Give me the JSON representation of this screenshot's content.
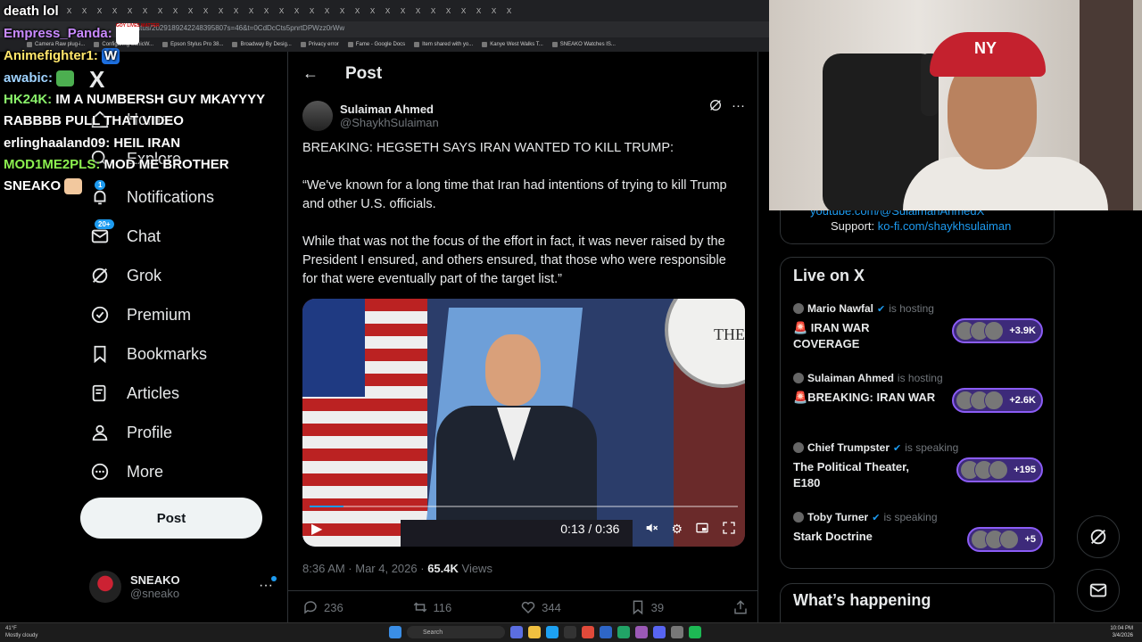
{
  "browser": {
    "url": "...atus/2029189242248395807s=46&t=0CdDcCts5pnrtDPWzz0rWw",
    "bookmarks": [
      "Camera Raw plug-i...",
      "Configuring SonicW...",
      "Epson Stylus Pro 38...",
      "Broadway By Desig...",
      "Privacy error",
      "Fame - Google Docs",
      "Item shared with yo...",
      "Kanye West Walks T...",
      "SNEAKO Watches IS..."
    ]
  },
  "chat": {
    "messages": [
      {
        "user": "",
        "text": "death lol"
      },
      {
        "user": "Empress_Panda:",
        "text": ""
      },
      {
        "user": "Animefighter1:",
        "text": ""
      },
      {
        "user": "awabic:",
        "text": ""
      },
      {
        "user": "HK24K:",
        "text": "IM A NUMBERSH GUY MKAYYYY RABBBB PULL THAT VIDEO"
      },
      {
        "user": "",
        "text": "erlinghaaland09: HEIL IRAN"
      },
      {
        "user": "MOD1ME2PLS:",
        "text": "MOD ME BROTHER SNEAKO"
      }
    ],
    "emote_text": "GOY LIVES MATTER",
    "w_emote": "W"
  },
  "sidebar": {
    "logo": "X",
    "items": [
      {
        "label": "Home",
        "icon": "home-icon"
      },
      {
        "label": "Explore",
        "icon": "search-icon"
      },
      {
        "label": "Notifications",
        "icon": "bell-icon",
        "badge": "1"
      },
      {
        "label": "Chat",
        "icon": "mail-icon",
        "badge": "20+"
      },
      {
        "label": "Grok",
        "icon": "grok-icon"
      },
      {
        "label": "Premium",
        "icon": "verified-icon"
      },
      {
        "label": "Bookmarks",
        "icon": "bookmark-icon"
      },
      {
        "label": "Articles",
        "icon": "articles-icon"
      },
      {
        "label": "Profile",
        "icon": "person-icon"
      },
      {
        "label": "More",
        "icon": "more-circle-icon"
      }
    ],
    "post_button": "Post",
    "account": {
      "name": "SNEAKO",
      "handle": "@sneako",
      "more": "···"
    }
  },
  "main": {
    "back": "←",
    "title": "Post",
    "author": {
      "name": "Sulaiman Ahmed",
      "handle": "@ShaykhSulaiman"
    },
    "paragraphs": [
      "BREAKING: HEGSETH SAYS IRAN WANTED TO KILL TRUMP:",
      "“We've known for a long time that Iran had intentions of trying to kill Trump and other U.S. officials.",
      "While that was not the focus of the effort in fact, it was never raised by the President I ensured, and others ensured, that those who were responsible for that were eventually part of the target list.”"
    ],
    "video": {
      "time": "0:13 / 0:36",
      "seal_text": "THE",
      "progress": 0.08
    },
    "meta": {
      "time": "8:36 AM · Mar 4, 2026 · ",
      "views": "65.4K",
      "views_label": " Views"
    },
    "actions": {
      "replies": "236",
      "reposts": "116",
      "likes": "344",
      "bookmarks": "39"
    }
  },
  "right": {
    "bio_link": "youtube.com/@SulaimanAhmedX",
    "support_label": "Support:",
    "support_link": "ko-fi.com/shaykhsulaiman",
    "live_title": "Live on X",
    "spaces": [
      {
        "host": "Mario Nawfal",
        "status": "is hosting",
        "title": "🚨 IRAN WAR COVERAGE",
        "count": "+3.9K"
      },
      {
        "host": "Sulaiman Ahmed",
        "status": "is hosting",
        "title": "🚨BREAKING: IRAN WAR",
        "count": "+2.6K"
      },
      {
        "host": "Chief Trumpster",
        "status": "is speaking",
        "title": "The Political Theater, E180",
        "count": "+195"
      },
      {
        "host": "Toby Turner",
        "status": "is speaking",
        "title": "Stark Doctrine",
        "count": "+5"
      }
    ],
    "happening": "What’s happening"
  },
  "webcam": {
    "cap_logo": "NY"
  },
  "taskbar": {
    "weather_temp": "41°F",
    "weather_desc": "Mostly cloudy",
    "search": "Search",
    "time": "10:04 PM",
    "date": "3/4/2026"
  }
}
